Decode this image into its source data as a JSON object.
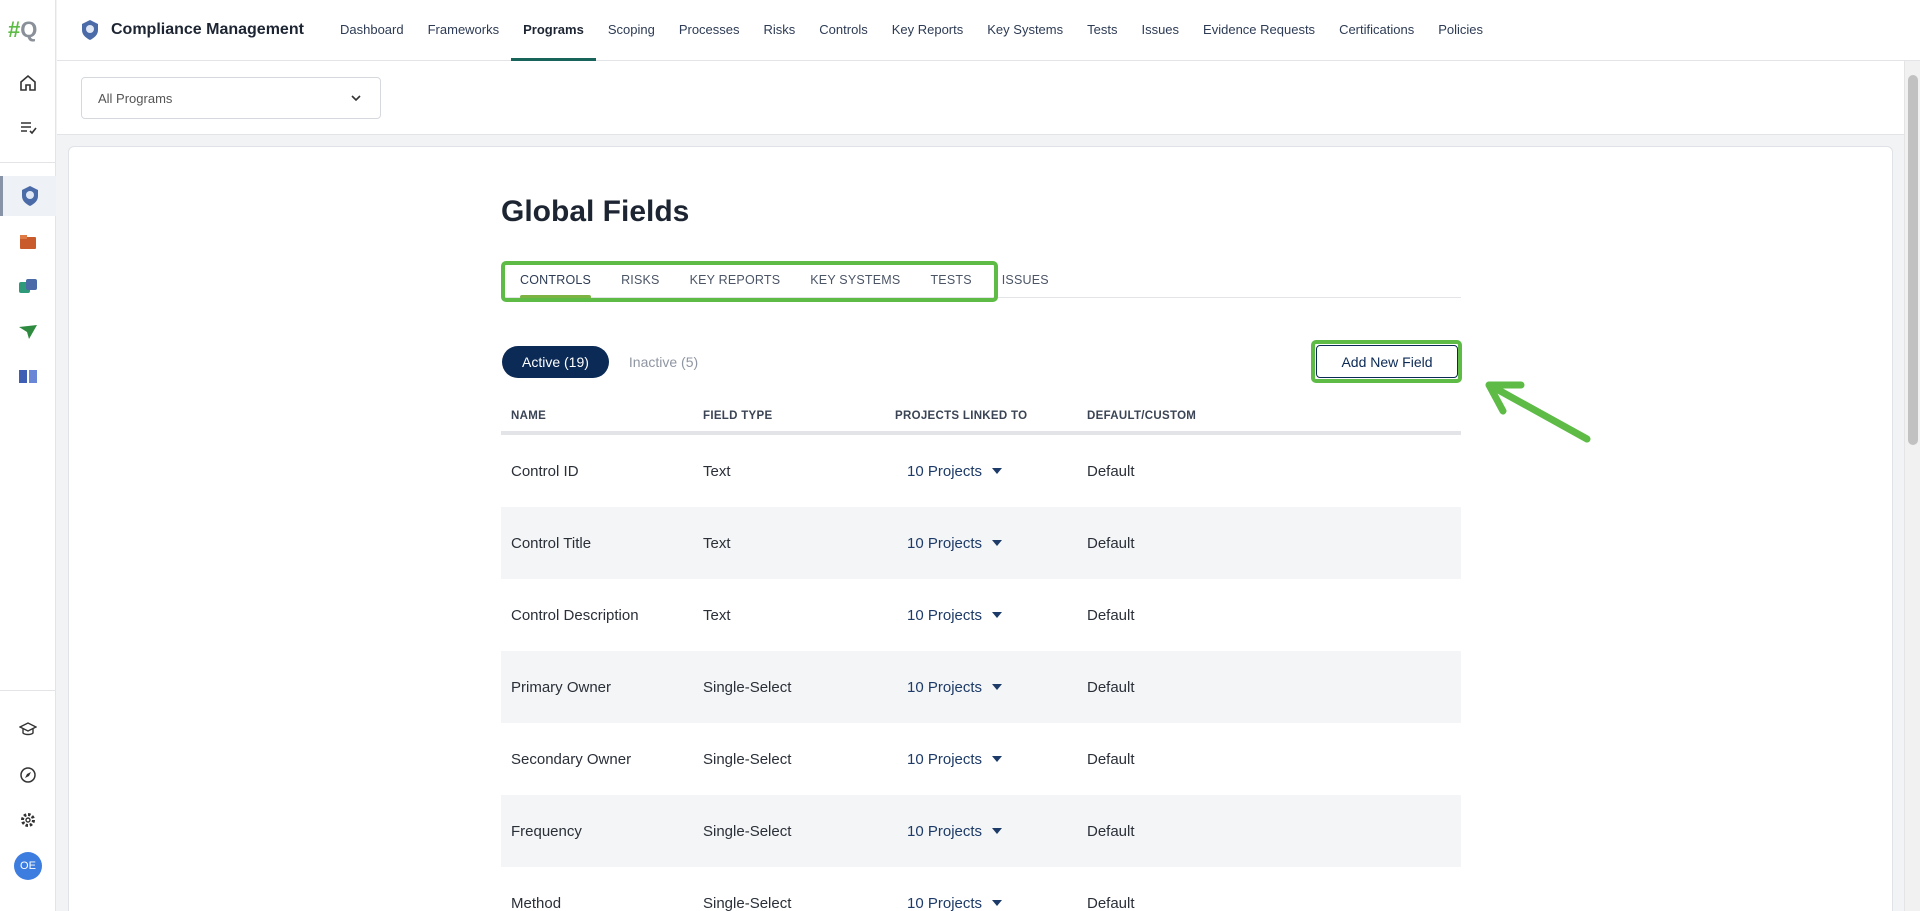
{
  "app": {
    "logo_text_hash": "#",
    "logo_text_q": "Q",
    "module_title": "Compliance Management"
  },
  "nav": {
    "items": [
      {
        "label": "Dashboard",
        "active": false
      },
      {
        "label": "Frameworks",
        "active": false
      },
      {
        "label": "Programs",
        "active": true
      },
      {
        "label": "Scoping",
        "active": false
      },
      {
        "label": "Processes",
        "active": false
      },
      {
        "label": "Risks",
        "active": false
      },
      {
        "label": "Controls",
        "active": false
      },
      {
        "label": "Key Reports",
        "active": false
      },
      {
        "label": "Key Systems",
        "active": false
      },
      {
        "label": "Tests",
        "active": false
      },
      {
        "label": "Issues",
        "active": false
      },
      {
        "label": "Evidence Requests",
        "active": false
      },
      {
        "label": "Certifications",
        "active": false
      },
      {
        "label": "Policies",
        "active": false
      }
    ]
  },
  "sidebar": {
    "icons": [
      "home-icon",
      "tasks-list-icon",
      "compliance-badge-icon",
      "folder-icon",
      "sync-icon",
      "paper-plane-icon",
      "book-icon",
      "learning-cap-icon",
      "compass-icon",
      "gear-icon"
    ],
    "avatar_initials": "OE"
  },
  "filter": {
    "program_select_value": "All Programs"
  },
  "page": {
    "title": "Global Fields",
    "tabs": [
      "CONTROLS",
      "RISKS",
      "KEY REPORTS",
      "KEY SYSTEMS",
      "TESTS",
      "ISSUES"
    ],
    "active_tab": "CONTROLS",
    "filter_active": "Active (19)",
    "filter_inactive": "Inactive (5)",
    "add_button": "Add New Field"
  },
  "table": {
    "headers": [
      "NAME",
      "FIELD TYPE",
      "PROJECTS LINKED TO",
      "DEFAULT/CUSTOM"
    ],
    "rows": [
      {
        "name": "Control ID",
        "type": "Text",
        "projects": "10 Projects",
        "kind": "Default"
      },
      {
        "name": "Control Title",
        "type": "Text",
        "projects": "10 Projects",
        "kind": "Default"
      },
      {
        "name": "Control Description",
        "type": "Text",
        "projects": "10 Projects",
        "kind": "Default"
      },
      {
        "name": "Primary Owner",
        "type": "Single-Select",
        "projects": "10 Projects",
        "kind": "Default"
      },
      {
        "name": "Secondary Owner",
        "type": "Single-Select",
        "projects": "10 Projects",
        "kind": "Default"
      },
      {
        "name": "Frequency",
        "type": "Single-Select",
        "projects": "10 Projects",
        "kind": "Default"
      },
      {
        "name": "Method",
        "type": "Single-Select",
        "projects": "10 Projects",
        "kind": "Default"
      }
    ]
  },
  "colors": {
    "accent_navy": "#0b2a55",
    "highlight_green": "#5dbb46",
    "nav_active_underline": "#18645a"
  }
}
